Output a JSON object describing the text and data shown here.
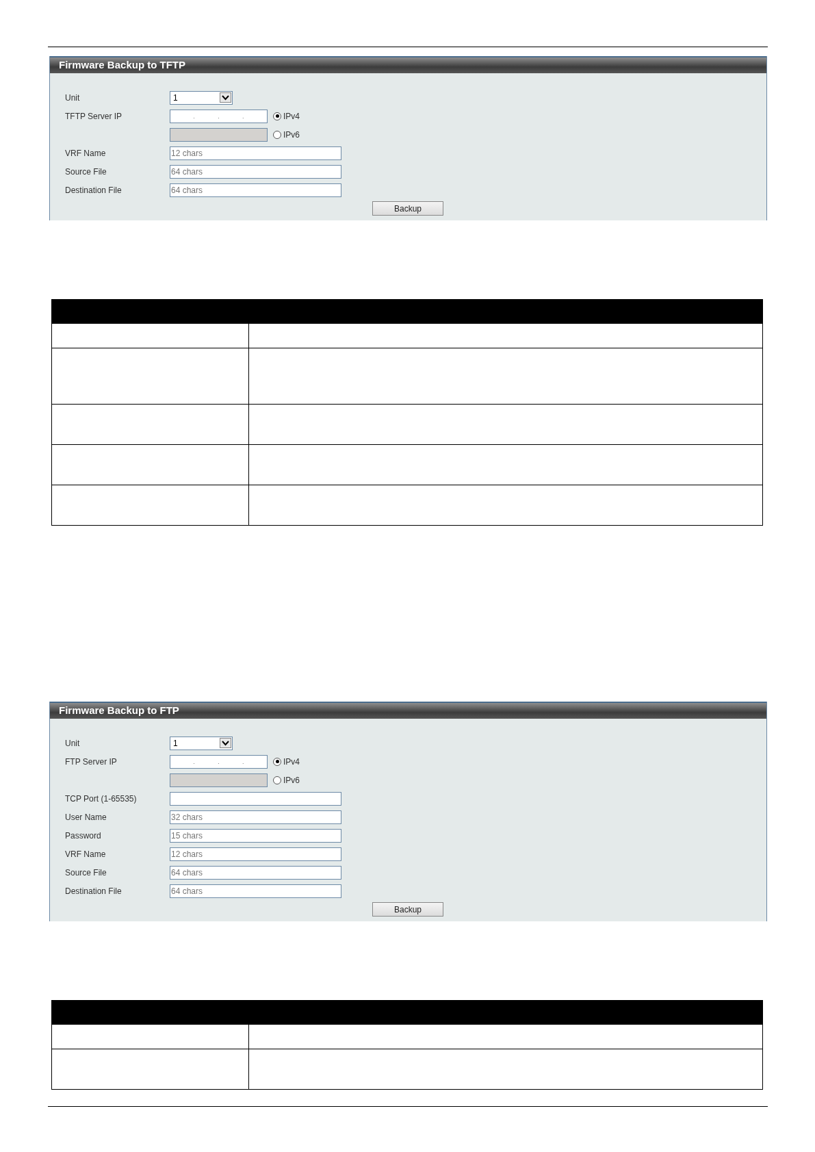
{
  "sections": [
    {
      "panel": {
        "title": "Firmware Backup to TFTP",
        "fields": [
          {
            "kind": "select",
            "label": "Unit",
            "value": "1"
          },
          {
            "kind": "ip",
            "label": "TFTP Server IP",
            "separators": [
              ".",
              ".",
              "."
            ],
            "options": [
              {
                "label": "IPv4",
                "selected": true
              },
              {
                "label": "IPv6",
                "selected": false
              }
            ]
          },
          {
            "kind": "text",
            "label": "VRF Name",
            "placeholder": "12 chars"
          },
          {
            "kind": "text",
            "label": "Source File",
            "placeholder": "64 chars"
          },
          {
            "kind": "text",
            "label": "Destination File",
            "placeholder": "64 chars"
          }
        ],
        "button": "Backup"
      },
      "table": {
        "rows": [
          {
            "kind": "single"
          },
          {
            "kind": "triple"
          },
          {
            "kind": "double"
          },
          {
            "kind": "double"
          },
          {
            "kind": "double"
          }
        ]
      }
    },
    {
      "panel": {
        "title": "Firmware Backup to FTP",
        "fields": [
          {
            "kind": "select",
            "label": "Unit",
            "value": "1"
          },
          {
            "kind": "ip",
            "label": "FTP Server IP",
            "separators": [
              ".",
              ".",
              "."
            ],
            "options": [
              {
                "label": "IPv4",
                "selected": true
              },
              {
                "label": "IPv6",
                "selected": false
              }
            ]
          },
          {
            "kind": "text",
            "label": "TCP Port (1-65535)"
          },
          {
            "kind": "text",
            "label": "User Name",
            "placeholder": "32 chars"
          },
          {
            "kind": "text",
            "label": "Password",
            "placeholder": "15 chars"
          },
          {
            "kind": "text",
            "label": "VRF Name",
            "placeholder": "12 chars"
          },
          {
            "kind": "text",
            "label": "Source File",
            "placeholder": "64 chars"
          },
          {
            "kind": "text",
            "label": "Destination File",
            "placeholder": "64 chars"
          }
        ],
        "button": "Backup"
      },
      "table": {
        "rows": [
          {
            "kind": "single"
          },
          {
            "kind": "double"
          }
        ]
      }
    }
  ]
}
